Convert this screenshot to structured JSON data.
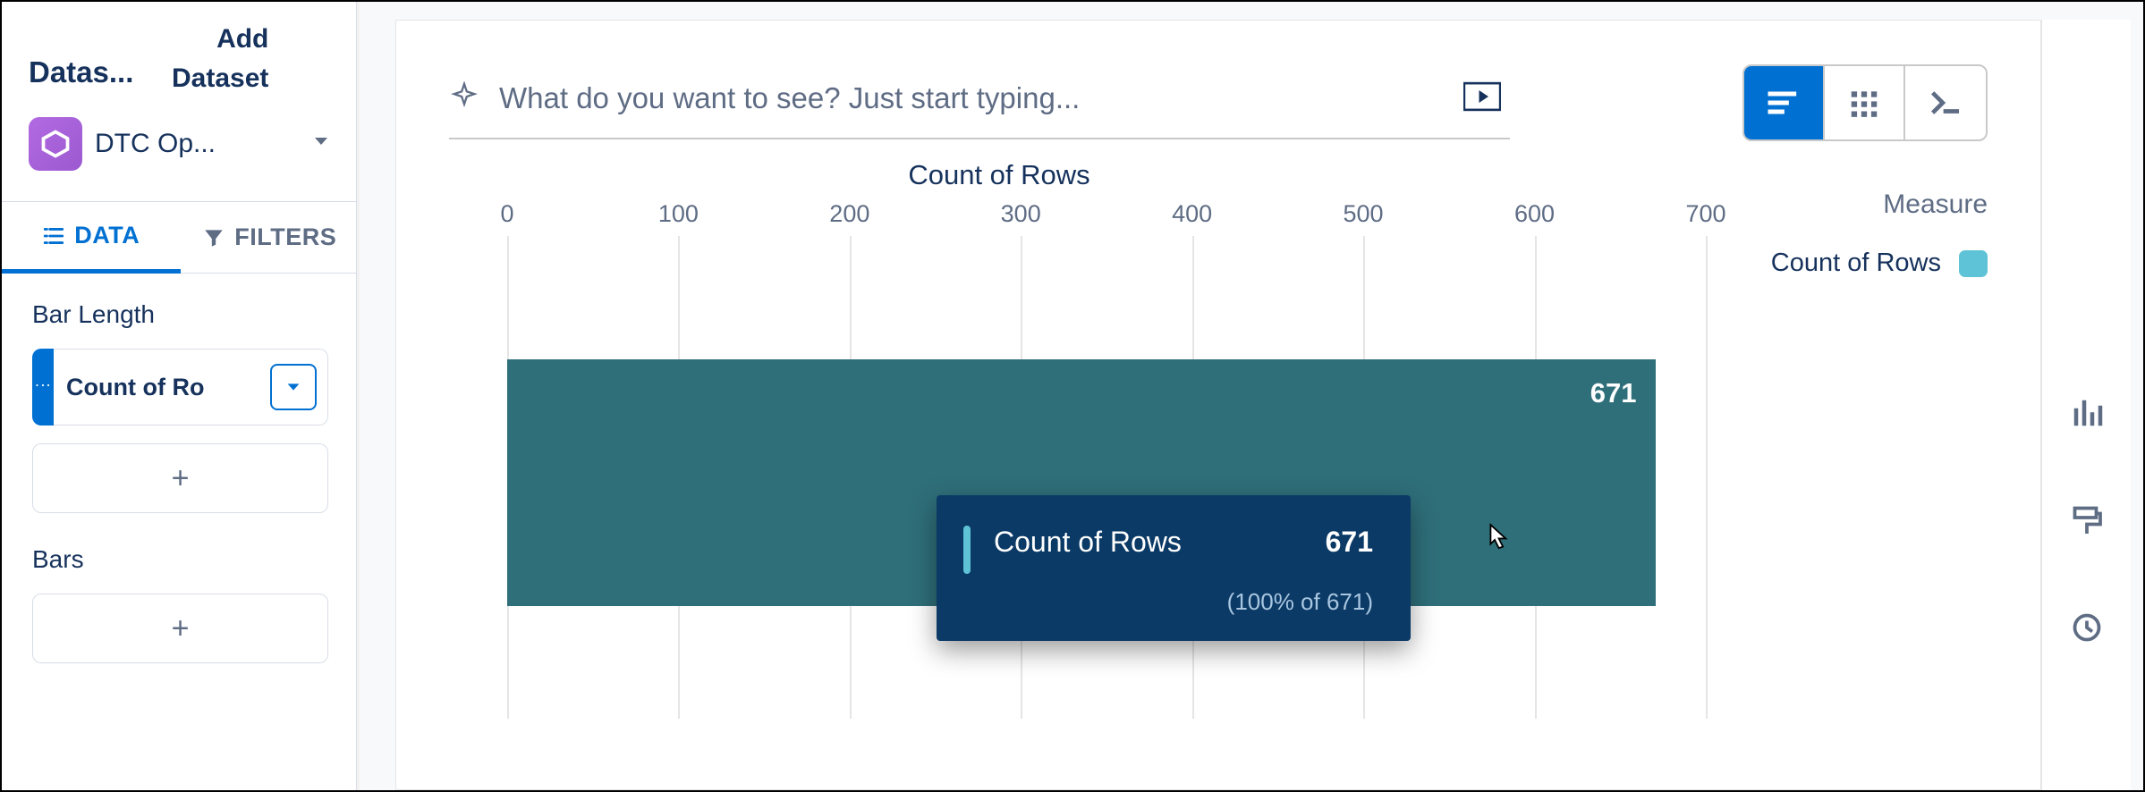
{
  "sidebar": {
    "datasets_label": "Datas...",
    "add_dataset_line1": "Add",
    "add_dataset_line2": "Dataset",
    "selected_dataset": "DTC Op...",
    "tabs": {
      "data": "DATA",
      "filters": "FILTERS"
    },
    "bar_length_label": "Bar Length",
    "bar_length_pill": "Count of Ro",
    "bars_label": "Bars",
    "plus_glyph": "+"
  },
  "query": {
    "placeholder": "What do you want to see? Just start typing..."
  },
  "legend": {
    "title": "Measure",
    "item": "Count of Rows"
  },
  "axis_title": "Count of Rows",
  "ticks": [
    "0",
    "100",
    "200",
    "300",
    "400",
    "500",
    "600",
    "700"
  ],
  "bar_value_label": "671",
  "tooltip": {
    "label": "Count of Rows",
    "value": "671",
    "sub": "(100% of 671)"
  },
  "chart_data": {
    "type": "bar",
    "orientation": "horizontal",
    "title": "Count of Rows",
    "xlabel": "Count of Rows",
    "ylabel": "",
    "xlim": [
      0,
      700
    ],
    "categories": [
      ""
    ],
    "values": [
      671
    ],
    "series": [
      {
        "name": "Count of Rows",
        "values": [
          671
        ],
        "color": "#2f6f7a"
      }
    ],
    "legend": {
      "position": "right",
      "title": "Measure"
    },
    "grid": true
  }
}
